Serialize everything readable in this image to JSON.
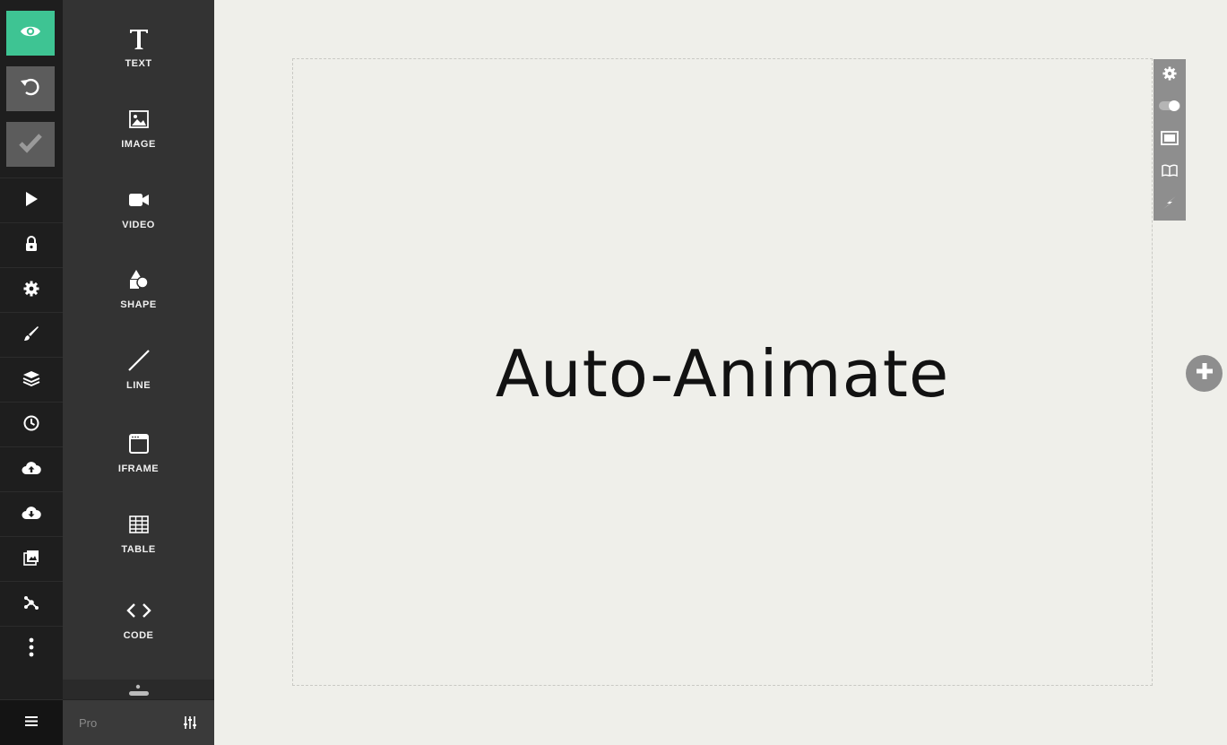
{
  "rail": {
    "top_buttons": [
      {
        "name": "preview",
        "icon": "eye-icon",
        "color": "#3ec493"
      },
      {
        "name": "undo",
        "icon": "undo-icon"
      },
      {
        "name": "save",
        "icon": "checkmark-icon"
      }
    ],
    "items": [
      {
        "icon": "play-icon"
      },
      {
        "icon": "lock-icon"
      },
      {
        "icon": "gear-icon"
      },
      {
        "icon": "brush-icon"
      },
      {
        "icon": "layers-icon"
      },
      {
        "icon": "clock-icon"
      },
      {
        "icon": "cloud-upload-icon"
      },
      {
        "icon": "cloud-download-icon"
      },
      {
        "icon": "images-icon"
      },
      {
        "icon": "share-icon"
      },
      {
        "icon": "more-vertical-icon"
      }
    ],
    "menu_icon": "hamburger-icon"
  },
  "tools": {
    "items": [
      {
        "label": "TEXT",
        "icon": "text-icon"
      },
      {
        "label": "IMAGE",
        "icon": "image-icon"
      },
      {
        "label": "VIDEO",
        "icon": "video-icon"
      },
      {
        "label": "SHAPE",
        "icon": "shape-icon"
      },
      {
        "label": "LINE",
        "icon": "line-icon"
      },
      {
        "label": "IFRAME",
        "icon": "iframe-icon"
      },
      {
        "label": "TABLE",
        "icon": "table-icon"
      },
      {
        "label": "CODE",
        "icon": "code-icon"
      }
    ],
    "footer": {
      "plan_label": "Pro",
      "settings_icon": "sliders-icon"
    }
  },
  "slide": {
    "title": "Auto-Animate"
  },
  "slide_toolbar": {
    "buttons": [
      {
        "icon": "gear-icon"
      },
      {
        "icon": "toggle-icon"
      },
      {
        "icon": "background-icon"
      },
      {
        "icon": "notes-icon"
      },
      {
        "icon": "lightning-icon"
      }
    ]
  },
  "add_slide_icon": "plus-icon",
  "colors": {
    "accent": "#3ec493",
    "canvas": "#efefea",
    "rail": "#1e1e1e",
    "panel": "#333333"
  }
}
